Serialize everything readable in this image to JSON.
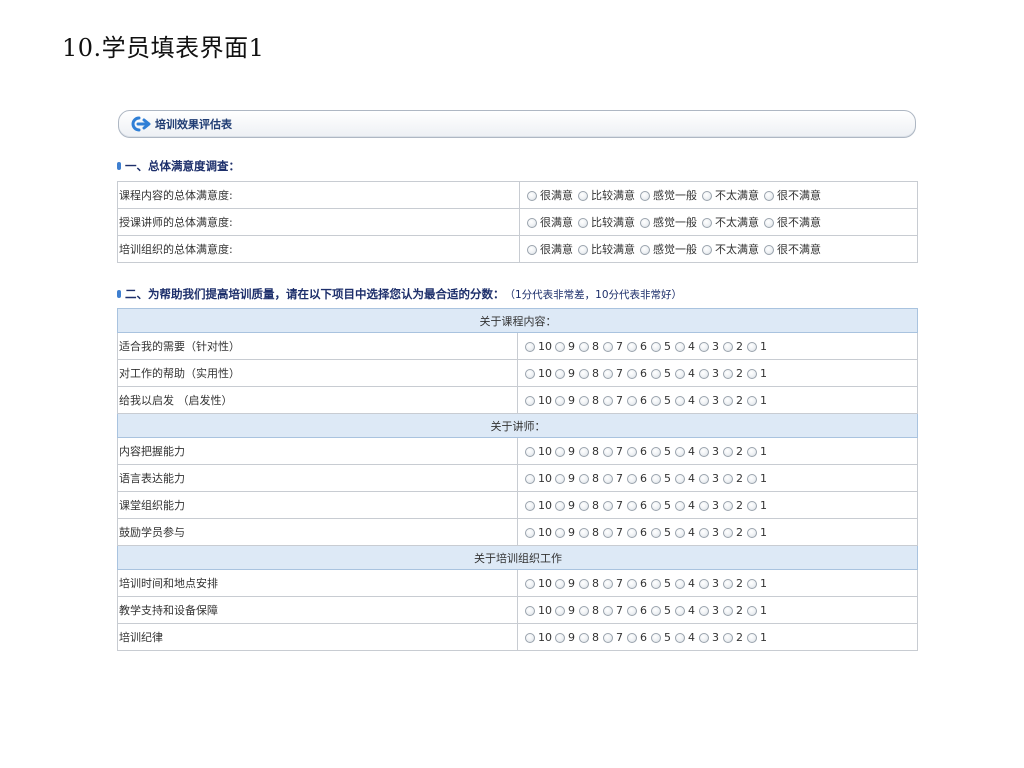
{
  "slide_title": "10.学员填表界面1",
  "panel": {
    "title": "培训效果评估表",
    "icon": "arrow-right-icon"
  },
  "section1": {
    "title": "一、总体满意度调查：",
    "options": [
      "很满意",
      "比较满意",
      "感觉一般",
      "不太满意",
      "很不满意"
    ],
    "rows": [
      {
        "label": "课程内容的总体满意度:"
      },
      {
        "label": "授课讲师的总体满意度:"
      },
      {
        "label": "培训组织的总体满意度:"
      }
    ]
  },
  "section2": {
    "title": "二、为帮助我们提高培训质量，请在以下项目中选择您认为最合适的分数：",
    "note": "（1分代表非常差，10分代表非常好）",
    "scores": [
      "10",
      "9",
      "8",
      "7",
      "6",
      "5",
      "4",
      "3",
      "2",
      "1"
    ],
    "groups": [
      {
        "title": "关于课程内容：",
        "rows": [
          "适合我的需要（针对性）",
          "对工作的帮助（实用性）",
          "给我以启发 （启发性）"
        ]
      },
      {
        "title": "关于讲师：",
        "rows": [
          "内容把握能力",
          "语言表达能力",
          "课堂组织能力",
          "鼓励学员参与"
        ]
      },
      {
        "title": "关于培训组织工作",
        "rows": [
          "培训时间和地点安排",
          "教学支持和设备保障",
          "培训纪律"
        ]
      }
    ]
  },
  "colors": {
    "header_text": "#1d2f6b",
    "group_bg": "#dde9f6",
    "accent": "#3f7fd0",
    "border": "#c8ccd2"
  }
}
